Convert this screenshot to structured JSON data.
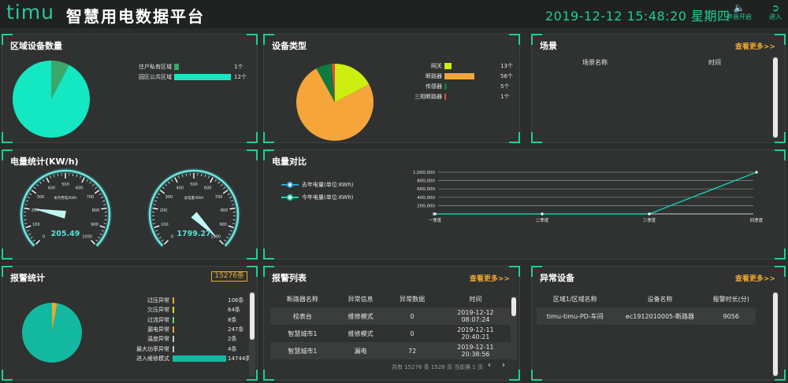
{
  "header": {
    "logo": "timu",
    "title": "智慧用电数据平台",
    "datetime": "2019-12-12 15:48:20 星期四",
    "sound_label": "声音开启",
    "enter_label": "进入",
    "sound_icon": "speaker-icon",
    "enter_icon": "login-icon",
    "accent": "#1fd08e"
  },
  "panels": {
    "area_devices": {
      "title": "区域设备数量"
    },
    "device_types": {
      "title": "设备类型"
    },
    "scenes": {
      "title": "场景",
      "more": "查看更多>>",
      "columns": [
        "场景名称",
        "时间"
      ]
    },
    "power_stats": {
      "title": "电量统计(KW/h)"
    },
    "power_compare": {
      "title": "电量对比"
    },
    "alarm_stats": {
      "title": "报警统计",
      "count_badge": "15276条"
    },
    "alarm_list": {
      "title": "报警列表",
      "more": "查看更多>>",
      "columns": [
        "断路器名称",
        "异常信息",
        "异常数据",
        "时间"
      ],
      "rows": [
        {
          "name": "校表台",
          "info": "维修模式",
          "data": "0",
          "time1": "2019-12-12",
          "time2": "08:07:24"
        },
        {
          "name": "智慧城市1",
          "info": "维修模式",
          "data": "0",
          "time1": "2019-12-11",
          "time2": "20:40:21"
        },
        {
          "name": "智慧城市1",
          "info": "漏电",
          "data": "72",
          "time1": "2019-12-11",
          "time2": "20:38:56"
        }
      ],
      "pager": "共有 15276 条 1528 页 当前第 1 页",
      "prev_icon": "chevron-left-icon",
      "next_icon": "chevron-right-icon"
    },
    "abnormal_devices": {
      "title": "异常设备",
      "more": "查看更多>>",
      "columns": [
        "区域1/区域名称",
        "设备名称",
        "报警时长(分)"
      ],
      "rows": [
        {
          "area": "timu-timu-PD-车间",
          "device": "ec1912010005-断路器",
          "duration": "9056"
        }
      ]
    }
  },
  "chart_data": [
    {
      "id": "area_devices",
      "type": "pie",
      "labels": [
        "住户私有区域",
        "园区公共区域"
      ],
      "values": [
        1,
        12
      ],
      "value_labels": [
        "1个",
        "12个"
      ],
      "colors": [
        "#3aa86a",
        "#13e8c2"
      ]
    },
    {
      "id": "device_types",
      "type": "pie",
      "labels": [
        "网关",
        "断路器",
        "传感器",
        "三相断路器"
      ],
      "values": [
        13,
        56,
        5,
        1
      ],
      "value_labels": [
        "13个",
        "56个",
        "5个",
        "1个"
      ],
      "colors": [
        "#ccee11",
        "#f5a53a",
        "#117a3e",
        "#e84a3a"
      ]
    },
    {
      "id": "power_stats",
      "type": "gauge",
      "gauges": [
        {
          "label": "本月用电/KWh",
          "value": 205.49,
          "min": 0,
          "max": 1000,
          "ticks": [
            "0",
            "100",
            "200",
            "300",
            "400",
            "500",
            "600",
            "700",
            "800",
            "900",
            "1000"
          ]
        },
        {
          "label": "总电量/KWh",
          "value": 1799.27,
          "min": 0,
          "max": 1000,
          "ticks": [
            "0",
            "100",
            "200",
            "300",
            "400",
            "500",
            "600",
            "700",
            "800",
            "900",
            "1000"
          ]
        }
      ]
    },
    {
      "id": "power_compare",
      "type": "line",
      "categories": [
        "一季度",
        "二季度",
        "三季度",
        "四季度"
      ],
      "series": [
        {
          "name": "去年电量(单位:KWh)",
          "values": [
            0,
            0,
            0,
            1000000
          ],
          "color": "#2aa6d8"
        },
        {
          "name": "今年电量(单位:KWh)",
          "values": [
            0,
            0,
            0,
            1000000
          ],
          "color": "#13d8b0"
        }
      ],
      "yticks": [
        "0",
        "200,000",
        "400,000",
        "600,000",
        "800,000",
        "1,000,000"
      ],
      "ylim": [
        0,
        1000000
      ]
    },
    {
      "id": "alarm_stats",
      "type": "pie",
      "labels": [
        "过压异常",
        "欠压异常",
        "过流异常",
        "漏电异常",
        "温度异常",
        "最大功率异常",
        "进入维修模式"
      ],
      "values": [
        106,
        64,
        8,
        247,
        2,
        4,
        14744
      ],
      "value_labels": [
        "106条",
        "64条",
        "8条",
        "247条",
        "2条",
        "4条",
        "14744条"
      ],
      "colors": [
        "#f0a830",
        "#e8e020",
        "#6ad86a",
        "#f0a830",
        "#c8c8c8",
        "#c8c8c8",
        "#13b8a0"
      ]
    }
  ]
}
